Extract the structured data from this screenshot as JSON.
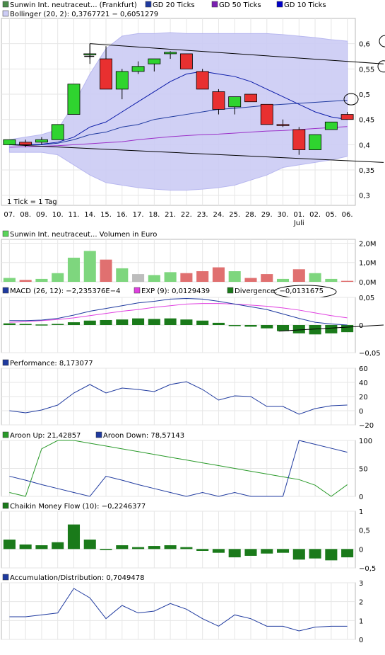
{
  "x_labels": [
    "07.",
    "08.",
    "09.",
    "10.",
    "11.",
    "14.",
    "15.",
    "16.",
    "17.",
    "18.",
    "21.",
    "22.",
    "23.",
    "24.",
    "25.",
    "28.",
    "29.",
    "30.",
    "01.",
    "02.",
    "05.",
    "06."
  ],
  "month_label": "Juli",
  "main": {
    "legend": [
      {
        "label": "Sunwin Int. neutraceut... (Frankfurt)",
        "color": "#4a8a4a"
      },
      {
        "label": "GD 20 Ticks",
        "color": "#1f3a9f"
      },
      {
        "label": "GD 50 Ticks",
        "color": "#7a1fb0"
      },
      {
        "label": "GD 10 Ticks",
        "color": "#0000c8"
      }
    ],
    "bollinger_label": "Bollinger (20, 2): 0,3767721 − 0,6051279",
    "tick_note": "1 Tick = 1 Tag",
    "y_ticks": [
      {
        "v": 0.6,
        "t": "0,6"
      },
      {
        "v": 0.55,
        "t": "0,55"
      },
      {
        "v": 0.5,
        "t": "0,5"
      },
      {
        "v": 0.45,
        "t": "0,45"
      },
      {
        "v": 0.4,
        "t": "0,4"
      },
      {
        "v": 0.35,
        "t": "0,35"
      },
      {
        "v": 0.3,
        "t": "0,3"
      }
    ],
    "ylim": [
      0.28,
      0.65
    ],
    "colors": {
      "up": "#2fd42f",
      "down": "#e83030",
      "band": "#ccccf5",
      "band_edge": "#b0b0ee"
    }
  },
  "volume": {
    "label": "Sunwin Int. neutraceut... Volumen in Euro",
    "y_ticks": [
      {
        "v": 0,
        "t": "0,0M"
      },
      {
        "v": 1,
        "t": "1,0M"
      },
      {
        "v": 2,
        "t": "2,0M"
      }
    ],
    "ylim": [
      0,
      2.2
    ]
  },
  "macd": {
    "label": "MACD (26, 12): −2,235376E−4",
    "exp_label": "EXP (9): 0,0129439",
    "div_label": "Divergence: −0,0131675",
    "y_ticks": [
      {
        "v": 0.05,
        "t": "0,05"
      },
      {
        "v": 0,
        "t": "0"
      },
      {
        "v": -0.05,
        "t": "−0,05"
      }
    ],
    "ylim": [
      -0.05,
      0.05
    ]
  },
  "performance": {
    "label": "Performance: 8,173077",
    "y_ticks": [
      {
        "v": 60,
        "t": "60"
      },
      {
        "v": 40,
        "t": "40"
      },
      {
        "v": 20,
        "t": "20"
      },
      {
        "v": 0,
        "t": "0"
      },
      {
        "v": -20,
        "t": "−20"
      }
    ],
    "ylim": [
      -20,
      60
    ]
  },
  "aroon": {
    "up_label": "Aroon Up: 21,42857",
    "down_label": "Aroon Down: 78,57143",
    "y_ticks": [
      {
        "v": 100,
        "t": "100"
      },
      {
        "v": 50,
        "t": "50"
      },
      {
        "v": 0,
        "t": "0"
      }
    ],
    "ylim": [
      0,
      100
    ]
  },
  "chaikin": {
    "label": "Chaikin Money Flow (10): −0,2246377",
    "y_ticks": [
      {
        "v": 1,
        "t": "1"
      },
      {
        "v": 0.5,
        "t": "0,5"
      },
      {
        "v": 0,
        "t": "0"
      },
      {
        "v": -0.5,
        "t": "−0,5"
      }
    ],
    "ylim": [
      -0.5,
      1
    ]
  },
  "accdist": {
    "label": "Accumulation/Distribution: 0,7049478",
    "y_ticks": [
      {
        "v": 3,
        "t": "3"
      },
      {
        "v": 2,
        "t": "2"
      },
      {
        "v": 1,
        "t": "1"
      },
      {
        "v": 0,
        "t": "0"
      }
    ],
    "ylim": [
      0,
      3
    ]
  },
  "chart_data": [
    {
      "type": "candlestick",
      "title": "Sunwin Int. neutraceut... (Frankfurt)",
      "categories": [
        "07.",
        "08.",
        "09.",
        "10.",
        "11.",
        "14.",
        "15.",
        "16.",
        "17.",
        "18.",
        "21.",
        "22.",
        "23.",
        "24.",
        "25.",
        "28.",
        "29.",
        "30.",
        "01.",
        "02.",
        "05.",
        "06."
      ],
      "ohlc": [
        [
          0.4,
          0.41,
          0.4,
          0.41
        ],
        [
          0.405,
          0.41,
          0.395,
          0.4
        ],
        [
          0.405,
          0.415,
          0.4,
          0.41
        ],
        [
          0.41,
          0.44,
          0.41,
          0.44
        ],
        [
          0.46,
          0.52,
          0.46,
          0.52
        ],
        [
          0.58,
          0.6,
          0.57,
          0.58
        ],
        [
          0.57,
          0.595,
          0.51,
          0.51
        ],
        [
          0.51,
          0.55,
          0.49,
          0.545
        ],
        [
          0.545,
          0.565,
          0.54,
          0.555
        ],
        [
          0.56,
          0.57,
          0.545,
          0.57
        ],
        [
          0.58,
          0.585,
          0.57,
          0.583
        ],
        [
          0.58,
          0.58,
          0.55,
          0.55
        ],
        [
          0.545,
          0.55,
          0.51,
          0.51
        ],
        [
          0.505,
          0.51,
          0.46,
          0.47
        ],
        [
          0.475,
          0.495,
          0.46,
          0.495
        ],
        [
          0.5,
          0.5,
          0.485,
          0.485
        ],
        [
          0.48,
          0.48,
          0.44,
          0.44
        ],
        [
          0.44,
          0.45,
          0.435,
          0.438
        ],
        [
          0.43,
          0.435,
          0.38,
          0.39
        ],
        [
          0.39,
          0.42,
          0.39,
          0.42
        ],
        [
          0.43,
          0.445,
          0.43,
          0.445
        ],
        [
          0.46,
          0.465,
          0.45,
          0.45
        ]
      ],
      "gd10": [
        0.4,
        0.4,
        0.401,
        0.405,
        0.415,
        0.435,
        0.445,
        0.465,
        0.485,
        0.505,
        0.525,
        0.54,
        0.545,
        0.54,
        0.535,
        0.525,
        0.51,
        0.495,
        0.48,
        0.465,
        0.455,
        0.45
      ],
      "gd20": [
        0.4,
        0.4,
        0.4,
        0.403,
        0.41,
        0.42,
        0.425,
        0.435,
        0.44,
        0.45,
        0.455,
        0.46,
        0.465,
        0.47,
        0.472,
        0.475,
        0.478,
        0.48,
        0.482,
        0.484,
        0.486,
        0.488
      ],
      "gd50": [
        0.395,
        0.396,
        0.397,
        0.398,
        0.4,
        0.402,
        0.404,
        0.406,
        0.41,
        0.413,
        0.416,
        0.418,
        0.42,
        0.421,
        0.423,
        0.425,
        0.427,
        0.428,
        0.43,
        0.432,
        0.434,
        0.436
      ],
      "bollinger_upper": [
        0.41,
        0.415,
        0.42,
        0.43,
        0.48,
        0.54,
        0.59,
        0.615,
        0.62,
        0.62,
        0.622,
        0.62,
        0.62,
        0.62,
        0.62,
        0.62,
        0.62,
        0.618,
        0.615,
        0.612,
        0.608,
        0.605
      ],
      "bollinger_lower": [
        0.385,
        0.385,
        0.385,
        0.38,
        0.36,
        0.34,
        0.325,
        0.32,
        0.315,
        0.312,
        0.31,
        0.31,
        0.312,
        0.315,
        0.32,
        0.33,
        0.34,
        0.355,
        0.36,
        0.365,
        0.37,
        0.377
      ],
      "trendlines": [
        {
          "x0": 5,
          "y0": 0.6,
          "x1": 22,
          "y1": 0.56
        },
        {
          "x0": 0,
          "y0": 0.4,
          "x1": 22,
          "y1": 0.365
        }
      ],
      "yticks": [
        0.6,
        0.55,
        0.5,
        0.45,
        0.4,
        0.35,
        0.3
      ]
    },
    {
      "type": "bar",
      "title": "Sunwin Int. neutraceut... Volumen in Euro",
      "categories": [
        "07.",
        "08.",
        "09.",
        "10.",
        "11.",
        "14.",
        "15.",
        "16.",
        "17.",
        "18.",
        "21.",
        "22.",
        "23.",
        "24.",
        "25.",
        "28.",
        "29.",
        "30.",
        "01.",
        "02.",
        "05.",
        "06."
      ],
      "values": [
        0.2,
        0.1,
        0.15,
        0.45,
        1.25,
        1.6,
        1.15,
        0.7,
        0.4,
        0.35,
        0.5,
        0.45,
        0.55,
        0.75,
        0.55,
        0.2,
        0.4,
        0.15,
        0.65,
        0.45,
        0.15,
        0.05
      ],
      "bar_colors": [
        "up",
        "down",
        "up",
        "up",
        "up",
        "up",
        "down",
        "up",
        "neutral",
        "up",
        "up",
        "down",
        "down",
        "down",
        "up",
        "down",
        "down",
        "up",
        "down",
        "up",
        "up",
        "down"
      ],
      "unit": "M Euro"
    },
    {
      "type": "line",
      "title": "MACD (26, 12)",
      "series": [
        {
          "name": "MACD (26, 12)",
          "values": [
            0.008,
            0.008,
            0.009,
            0.012,
            0.018,
            0.025,
            0.03,
            0.035,
            0.04,
            0.043,
            0.047,
            0.048,
            0.047,
            0.043,
            0.038,
            0.033,
            0.028,
            0.02,
            0.012,
            0.005,
            0.002,
            0.0
          ]
        },
        {
          "name": "EXP (9)",
          "values": [
            0.005,
            0.006,
            0.008,
            0.01,
            0.013,
            0.017,
            0.021,
            0.025,
            0.028,
            0.032,
            0.035,
            0.038,
            0.039,
            0.039,
            0.038,
            0.036,
            0.034,
            0.031,
            0.027,
            0.022,
            0.017,
            0.013
          ]
        },
        {
          "name": "Divergence",
          "type": "bar",
          "values": [
            0.003,
            0.002,
            0.001,
            0.002,
            0.005,
            0.008,
            0.009,
            0.01,
            0.012,
            0.011,
            0.012,
            0.01,
            0.008,
            0.004,
            0.0,
            -0.003,
            -0.006,
            -0.011,
            -0.015,
            -0.017,
            -0.015,
            -0.013
          ]
        }
      ],
      "ylim": [
        -0.05,
        0.05
      ]
    },
    {
      "type": "line",
      "title": "Performance",
      "values": [
        0,
        -3,
        1,
        8,
        25,
        37,
        25,
        32,
        30,
        27,
        37,
        41,
        30,
        15,
        21,
        20,
        6,
        6,
        -5,
        3,
        7,
        8
      ],
      "ylim": [
        -20,
        60
      ]
    },
    {
      "type": "line",
      "title": "Aroon",
      "series": [
        {
          "name": "Aroon Up",
          "values": [
            7,
            0,
            85,
            100,
            100,
            95,
            90,
            85,
            80,
            75,
            70,
            65,
            60,
            55,
            50,
            45,
            40,
            35,
            30,
            20,
            0,
            21
          ]
        },
        {
          "name": "Aroon Down",
          "values": [
            36,
            29,
            21,
            14,
            7,
            0,
            36,
            29,
            21,
            14,
            7,
            0,
            7,
            0,
            7,
            0,
            0,
            0,
            100,
            93,
            86,
            79
          ]
        }
      ],
      "ylim": [
        0,
        100
      ]
    },
    {
      "type": "bar",
      "title": "Chaikin Money Flow (10)",
      "values": [
        0.25,
        0.12,
        0.1,
        0.18,
        0.65,
        0.25,
        -0.03,
        0.1,
        0.05,
        0.08,
        0.1,
        0.05,
        -0.05,
        -0.1,
        -0.22,
        -0.18,
        -0.12,
        -0.1,
        -0.28,
        -0.25,
        -0.3,
        -0.22
      ],
      "ylim": [
        -0.5,
        1
      ]
    },
    {
      "type": "line",
      "title": "Accumulation/Distribution",
      "values": [
        1.2,
        1.2,
        1.3,
        1.4,
        2.7,
        2.2,
        1.1,
        1.8,
        1.4,
        1.5,
        1.9,
        1.6,
        1.1,
        0.7,
        1.3,
        1.1,
        0.7,
        0.7,
        0.45,
        0.65,
        0.7,
        0.7
      ],
      "ylim": [
        0,
        3
      ]
    }
  ]
}
